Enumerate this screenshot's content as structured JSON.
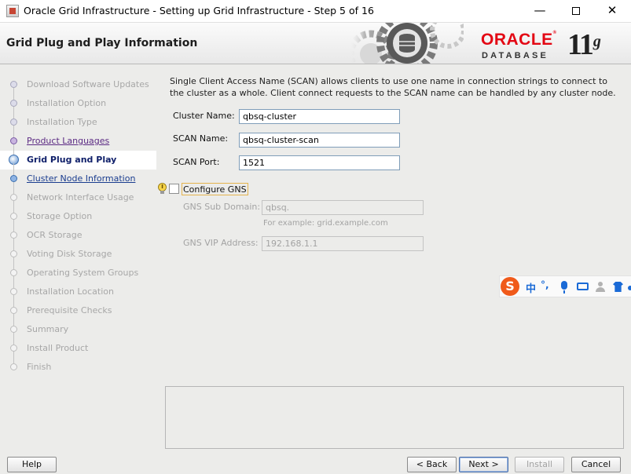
{
  "window": {
    "title": "Oracle Grid Infrastructure - Setting up Grid Infrastructure - Step 5 of 16",
    "minimize_glyph": "—",
    "close_glyph": "✕"
  },
  "header": {
    "page_title": "Grid Plug and Play Information",
    "logo_brand": "ORACLE",
    "logo_product": "DATABASE",
    "logo_version": "11",
    "logo_version_suffix": "g"
  },
  "steps": [
    {
      "label": "Download Software Updates",
      "state": "done"
    },
    {
      "label": "Installation Option",
      "state": "done"
    },
    {
      "label": "Installation Type",
      "state": "done"
    },
    {
      "label": "Product Languages",
      "state": "link"
    },
    {
      "label": "Grid Plug and Play",
      "state": "current"
    },
    {
      "label": "Cluster Node Information",
      "state": "next"
    },
    {
      "label": "Network Interface Usage",
      "state": "pending"
    },
    {
      "label": "Storage Option",
      "state": "pending"
    },
    {
      "label": "OCR Storage",
      "state": "pending"
    },
    {
      "label": "Voting Disk Storage",
      "state": "pending"
    },
    {
      "label": "Operating System Groups",
      "state": "pending"
    },
    {
      "label": "Installation Location",
      "state": "pending"
    },
    {
      "label": "Prerequisite Checks",
      "state": "pending"
    },
    {
      "label": "Summary",
      "state": "pending"
    },
    {
      "label": "Install Product",
      "state": "pending"
    },
    {
      "label": "Finish",
      "state": "pending"
    }
  ],
  "main": {
    "description": "Single Client Access Name (SCAN) allows clients to use one name in connection strings to connect to the cluster as a whole. Client connect requests to the SCAN name can be handled by any cluster node.",
    "cluster_name_label": "Cluster Name:",
    "cluster_name_value": "qbsq-cluster",
    "scan_name_label": "SCAN Name:",
    "scan_name_value": "qbsq-cluster-scan",
    "scan_port_label": "SCAN Port:",
    "scan_port_value": "1521",
    "configure_gns_label": "Configure GNS",
    "configure_gns_checked": false,
    "gns_subdomain_label": "GNS Sub Domain:",
    "gns_subdomain_value": "qbsq.",
    "gns_subdomain_hint": "For example: grid.example.com",
    "gns_vip_label": "GNS VIP Address:",
    "gns_vip_value": "192.168.1.1"
  },
  "ime_toolbar": {
    "logo": "S",
    "mode": "中",
    "punctuation": "°,",
    "icons": [
      "microphone-icon",
      "keyboard-icon",
      "user-icon",
      "shirt-icon",
      "more-icon"
    ]
  },
  "buttons": {
    "help": "Help",
    "back": "< Back",
    "next": "Next >",
    "install": "Install",
    "cancel": "Cancel"
  },
  "colors": {
    "oracle_red": "#e30613",
    "current_step": "#10206a",
    "link_step": "#5b2a83",
    "next_step": "#1a3d8f",
    "ime_orange": "#f05a1a",
    "ime_blue": "#1a6ad6"
  }
}
